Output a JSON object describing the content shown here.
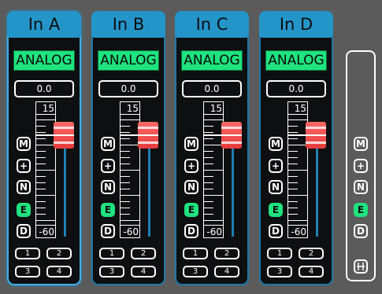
{
  "colors": {
    "background": "#5b5b5b",
    "channel_bg": "#0e0f10",
    "header": "#2495c9",
    "analog": "#1ee37e",
    "fader_knob": "#e53b3b",
    "meter": "#1f7fb4",
    "active_button": "#1ee37e"
  },
  "scale": {
    "max_label": "15",
    "min_label": "-60"
  },
  "channels": [
    {
      "name": "In A",
      "source": "ANALOG",
      "value": "0.0",
      "selected": true,
      "modes": [
        "M",
        "+",
        "N",
        "E",
        "D"
      ],
      "active_mode": "E",
      "routes": [
        "1",
        "2",
        "3",
        "4"
      ]
    },
    {
      "name": "In B",
      "source": "ANALOG",
      "value": "0.0",
      "selected": false,
      "modes": [
        "M",
        "+",
        "N",
        "E",
        "D"
      ],
      "active_mode": "E",
      "routes": [
        "1",
        "2",
        "3",
        "4"
      ]
    },
    {
      "name": "In C",
      "source": "ANALOG",
      "value": "0.0",
      "selected": false,
      "modes": [
        "M",
        "+",
        "N",
        "E",
        "D"
      ],
      "active_mode": "E",
      "routes": [
        "1",
        "2",
        "3",
        "4"
      ]
    },
    {
      "name": "In D",
      "source": "ANALOG",
      "value": "0.0",
      "selected": false,
      "modes": [
        "M",
        "+",
        "N",
        "E",
        "D"
      ],
      "active_mode": "E",
      "routes": [
        "1",
        "2",
        "3",
        "4"
      ]
    }
  ],
  "master": {
    "modes": [
      "M",
      "+",
      "N",
      "E",
      "D"
    ],
    "active_mode": "E",
    "link_icon": "link-channels-icon"
  }
}
